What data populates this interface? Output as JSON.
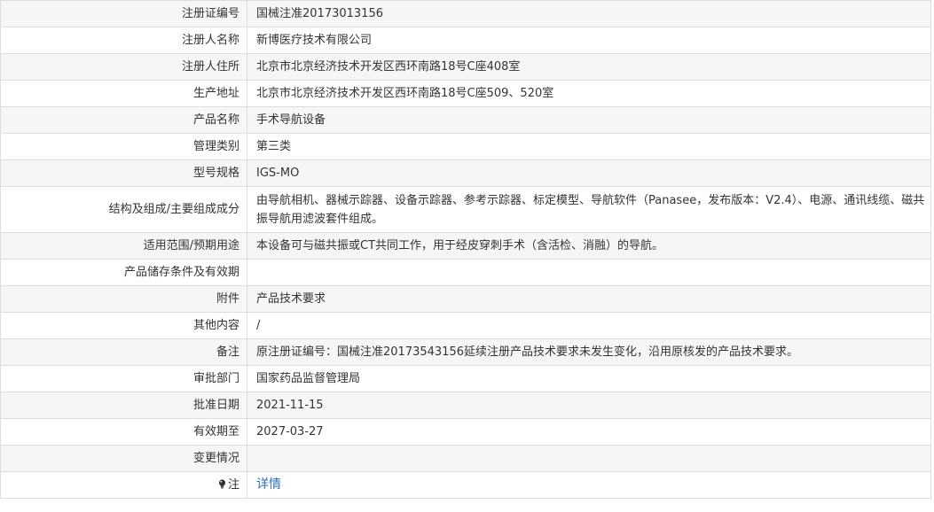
{
  "rows": [
    {
      "label": "注册证编号",
      "value": "国械注准20173013156"
    },
    {
      "label": "注册人名称",
      "value": "新博医疗技术有限公司"
    },
    {
      "label": "注册人住所",
      "value": "北京市北京经济技术开发区西环南路18号C座408室"
    },
    {
      "label": "生产地址",
      "value": "北京市北京经济技术开发区西环南路18号C座509、520室"
    },
    {
      "label": "产品名称",
      "value": "手术导航设备"
    },
    {
      "label": "管理类别",
      "value": "第三类"
    },
    {
      "label": "型号规格",
      "value": "IGS-MO"
    },
    {
      "label": "结构及组成/主要组成成分",
      "value": "由导航相机、器械示踪器、设备示踪器、参考示踪器、标定模型、导航软件（Panasee，发布版本：V2.4）、电源、通讯线缆、磁共振导航用滤波套件组成。"
    },
    {
      "label": "适用范围/预期用途",
      "value": "本设备可与磁共振或CT共同工作，用于经皮穿刺手术（含活检、消融）的导航。"
    },
    {
      "label": "产品储存条件及有效期",
      "value": ""
    },
    {
      "label": "附件",
      "value": "产品技术要求"
    },
    {
      "label": "其他内容",
      "value": "/"
    },
    {
      "label": "备注",
      "value": "原注册证编号：国械注准20173543156延续注册产品技术要求未发生变化，沿用原核发的产品技术要求。"
    },
    {
      "label": "审批部门",
      "value": "国家药品监督管理局"
    },
    {
      "label": "批准日期",
      "value": "2021-11-15"
    },
    {
      "label": "有效期至",
      "value": "2027-03-27"
    },
    {
      "label": "变更情况",
      "value": ""
    }
  ],
  "note": {
    "label": "注",
    "icon": "lightbulb-icon",
    "link": "详情"
  }
}
